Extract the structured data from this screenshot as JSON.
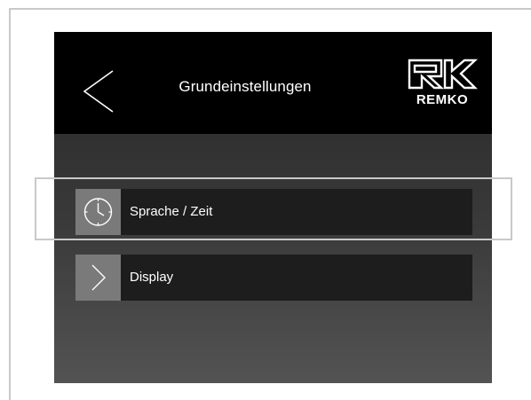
{
  "header": {
    "title": "Grundeinstellungen",
    "back_icon": "chevron-left-icon",
    "logo_text": "REMKO"
  },
  "menu": {
    "items": [
      {
        "label": "Sprache / Zeit",
        "icon": "clock-icon",
        "selected": true
      },
      {
        "label": "Display",
        "icon": "chevron-right-icon",
        "selected": false
      }
    ]
  },
  "colors": {
    "header_background": "#000000",
    "screen_gradient_top": "#2b2b2b",
    "screen_gradient_bottom": "#535353",
    "row_background": "#1d1d1d",
    "icon_tile": "#7a7a7a",
    "highlight_frame": "#c9c9c9",
    "text": "#ffffff"
  }
}
